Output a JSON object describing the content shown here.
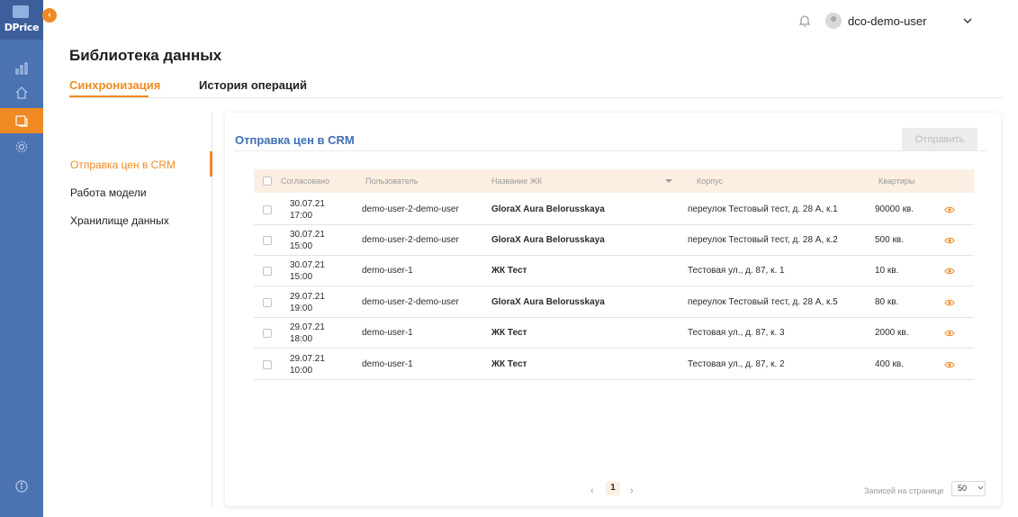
{
  "app": {
    "logo_text": "DPrice"
  },
  "user": {
    "name": "dco-demo-user"
  },
  "page": {
    "title": "Библиотека данных"
  },
  "tabs": [
    {
      "label": "Синхронизация",
      "active": true
    },
    {
      "label": "История операций",
      "active": false
    }
  ],
  "side_menu": [
    {
      "label": "Отправка цен в CRM",
      "active": true
    },
    {
      "label": "Работа модели",
      "active": false
    },
    {
      "label": "Хранилище данных",
      "active": false
    }
  ],
  "card": {
    "title": "Отправка цен в CRM",
    "send_label": "Отправить"
  },
  "table": {
    "columns": [
      "Согласовано",
      "Пользователь",
      "Название ЖК",
      "Корпус",
      "Квартиры"
    ],
    "rows": [
      {
        "date": "30.07.21",
        "time": "17:00",
        "user": "demo-user-2-demo-user",
        "complex": "GloraX Aura Belorusskaya",
        "building": "переулок Тестовый тест, д. 28 А, к.1",
        "flats": "90000 кв."
      },
      {
        "date": "30.07.21",
        "time": "15:00",
        "user": "demo-user-2-demo-user",
        "complex": "GloraX Aura Belorusskaya",
        "building": "переулок Тестовый тест, д. 28 А, к.2",
        "flats": "500 кв."
      },
      {
        "date": "30.07.21",
        "time": "15:00",
        "user": "demo-user-1",
        "complex": "ЖК Тест",
        "building": "Тестовая ул., д. 87, к. 1",
        "flats": "10 кв."
      },
      {
        "date": "29.07.21",
        "time": "19:00",
        "user": "demo-user-2-demo-user",
        "complex": "GloraX Aura Belorusskaya",
        "building": "переулок Тестовый тест, д. 28 А, к.5",
        "flats": "80 кв."
      },
      {
        "date": "29.07.21",
        "time": "18:00",
        "user": "demo-user-1",
        "complex": "ЖК Тест",
        "building": "Тестовая ул., д. 87, к. 3",
        "flats": "2000 кв."
      },
      {
        "date": "29.07.21",
        "time": "10:00",
        "user": "demo-user-1",
        "complex": "ЖК Тест",
        "building": "Тестовая ул., д. 87, к. 2",
        "flats": "400 кв."
      }
    ]
  },
  "pagination": {
    "prev": "‹",
    "current_page": "1",
    "next": "›",
    "per_page_label": "Записей на странице",
    "per_page_value": "50"
  },
  "colors": {
    "accent": "#f08a24",
    "rail": "#4b73b3",
    "link": "#3f6fb5",
    "header_row": "#fcefe2"
  },
  "icons": {
    "rail": [
      "chart-icon",
      "home-icon",
      "data-library-icon",
      "settings-icon",
      "info-icon"
    ],
    "top": [
      "bell-icon",
      "avatar",
      "chevron-down-icon"
    ],
    "row_action": "eye-icon"
  }
}
